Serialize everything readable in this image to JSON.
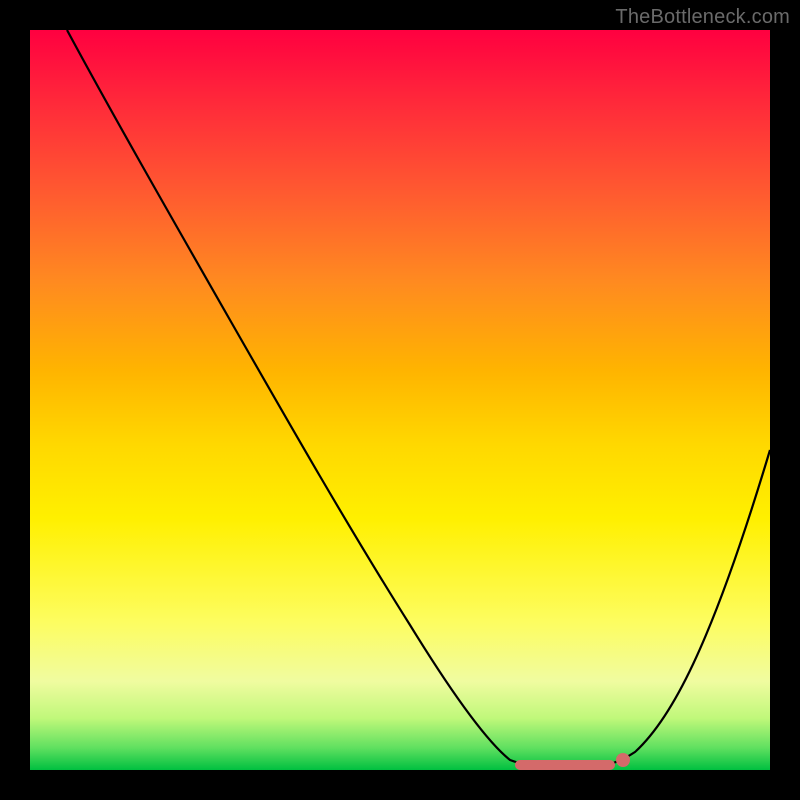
{
  "watermark": "TheBottleneck.com",
  "chart_data": {
    "type": "line",
    "title": "",
    "xlabel": "",
    "ylabel": "",
    "xlim": [
      0,
      100
    ],
    "ylim": [
      0,
      100
    ],
    "grid": false,
    "legend": false,
    "background": {
      "gradient": "vertical",
      "stops": [
        {
          "pos": 0,
          "color": "#ff0040"
        },
        {
          "pos": 50,
          "color": "#ffd800"
        },
        {
          "pos": 95,
          "color": "#c0f87a"
        },
        {
          "pos": 100,
          "color": "#00c040"
        }
      ]
    },
    "series": [
      {
        "name": "bottleneck-curve",
        "color": "#000000",
        "x": [
          5,
          10,
          20,
          30,
          40,
          50,
          58,
          63,
          67,
          72,
          78,
          82,
          88,
          94,
          100
        ],
        "values": [
          100,
          92,
          76,
          60,
          44,
          28,
          14,
          6,
          1,
          0,
          0,
          2,
          10,
          25,
          45
        ]
      }
    ],
    "annotations": [
      {
        "name": "optimal-range",
        "type": "segment",
        "color": "#d46a6a",
        "x_start": 67,
        "x_end": 79,
        "y": 0
      },
      {
        "name": "optimal-point",
        "type": "dot",
        "color": "#d46a6a",
        "x": 80,
        "y": 1
      }
    ]
  }
}
